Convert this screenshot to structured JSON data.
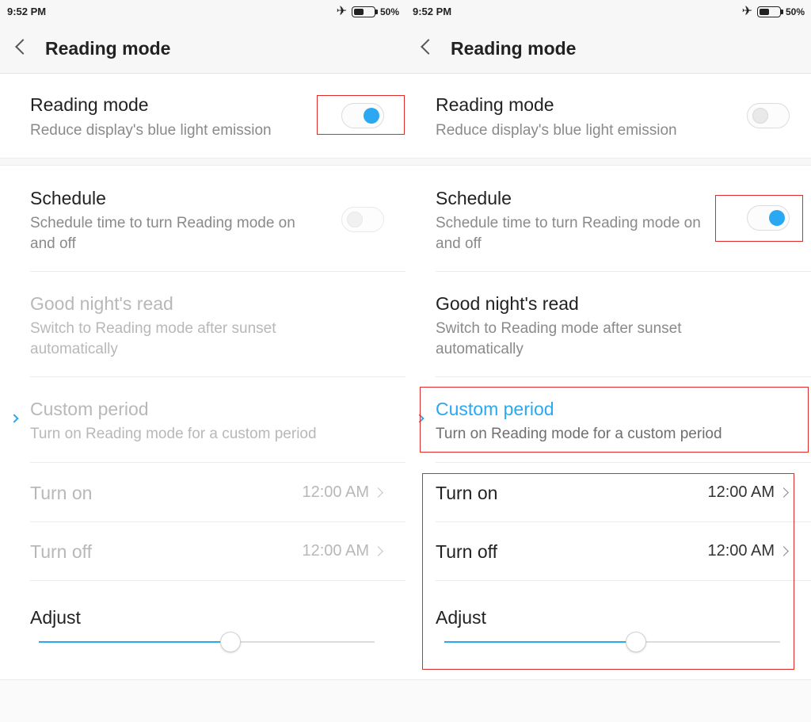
{
  "status_bar": {
    "time": "9:52 PM",
    "battery": "50%",
    "battery_level": 0.5,
    "airplane_icon": "airplane-icon"
  },
  "header": {
    "title": "Reading mode",
    "back_icon": "chevron-left-icon"
  },
  "settings": {
    "reading_mode": {
      "title": "Reading mode",
      "subtitle": "Reduce display's blue light emission"
    },
    "schedule": {
      "title": "Schedule",
      "subtitle": "Schedule time to turn Reading mode on and off"
    },
    "good_night": {
      "title": "Good night's read",
      "subtitle": "Switch to Reading mode after sunset automatically"
    },
    "custom_period": {
      "title": "Custom period",
      "subtitle": "Turn on Reading mode for a custom period"
    },
    "turn_on": {
      "label": "Turn on",
      "value": "12:00 AM"
    },
    "turn_off": {
      "label": "Turn off",
      "value": "12:00 AM"
    },
    "adjust": {
      "label": "Adjust",
      "level": 0.57
    }
  },
  "screens": [
    {
      "reading_mode_on": true,
      "schedule_on": false,
      "schedule_enabled": false
    },
    {
      "reading_mode_on": false,
      "schedule_on": true,
      "schedule_enabled": true
    }
  ],
  "colors": {
    "accent": "#2aa8f2",
    "highlight": "#e02b2b",
    "disabled_text": "#b8b8b8"
  }
}
